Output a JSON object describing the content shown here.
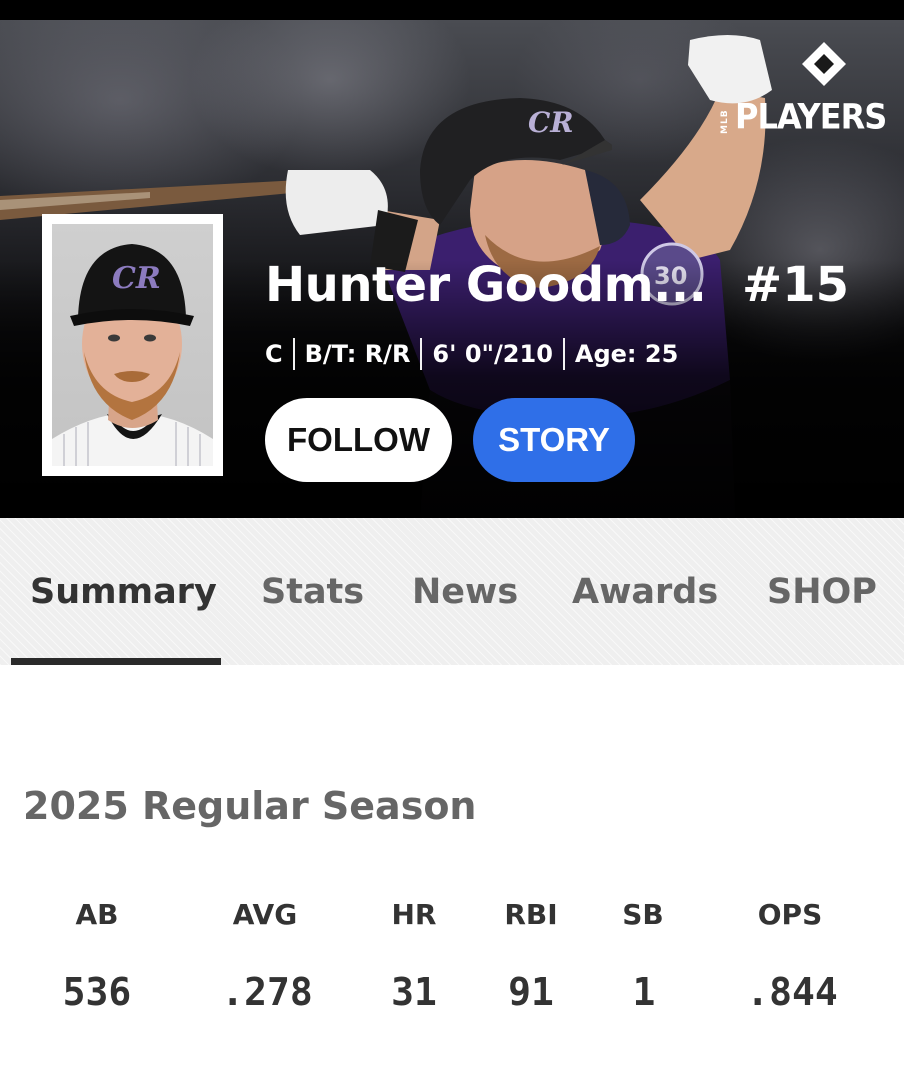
{
  "brand": {
    "mlb_text": "MLB",
    "players_text": "PLAYERS"
  },
  "player": {
    "name": "Hunter Goodm...",
    "number": "#15",
    "bio": [
      "C",
      "B/T: R/R",
      "6' 0\"/210",
      "Age: 25"
    ],
    "team_logo_icon": "rockies-cr-logo"
  },
  "actions": {
    "follow_label": "FOLLOW",
    "story_label": "STORY"
  },
  "tabs": [
    {
      "label": "Summary",
      "active": true
    },
    {
      "label": "Stats",
      "active": false
    },
    {
      "label": "News",
      "active": false
    },
    {
      "label": "Awards",
      "active": false
    },
    {
      "label": "SHOP",
      "active": false
    }
  ],
  "season": {
    "title": "2025 Regular Season",
    "stats": [
      {
        "label": "AB",
        "value": "536"
      },
      {
        "label": "AVG",
        "value": ".278"
      },
      {
        "label": "HR",
        "value": "31"
      },
      {
        "label": "RBI",
        "value": "91"
      },
      {
        "label": "SB",
        "value": "1"
      },
      {
        "label": "OPS",
        "value": ".844"
      }
    ]
  },
  "colors": {
    "story_button": "#2f6fe8",
    "follow_button": "#ffffff",
    "tab_active_text": "#333333",
    "tab_inactive_text": "#666666",
    "rockies_purple": "#33006f"
  }
}
